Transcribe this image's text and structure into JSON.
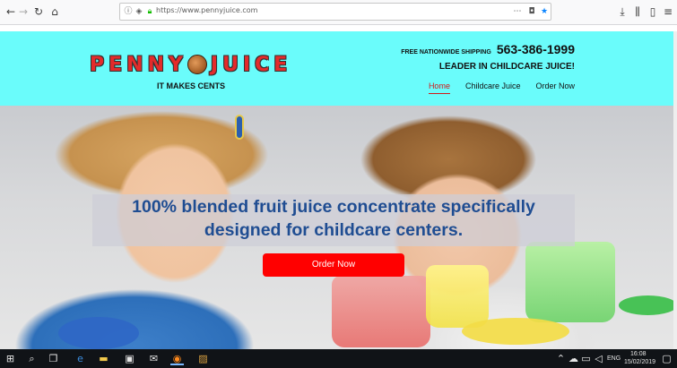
{
  "browser": {
    "url": "https://www.pennyjuice.com",
    "icons": [
      "arrow-left-icon",
      "arrow-right-icon",
      "reload-icon",
      "home-icon",
      "info-icon",
      "tracking-shield-icon",
      "lock-icon",
      "more-icon",
      "pocket-icon",
      "bookmark-star-icon",
      "download-icon",
      "library-icon",
      "sidebar-icon",
      "menu-icon"
    ]
  },
  "header": {
    "logo": {
      "left": "PENNY",
      "right": "JUICE"
    },
    "tagline": "IT MAKES CENTS",
    "shipping_label": "FREE NATIONWIDE SHIPPING",
    "phone": "563-386-1999",
    "leader": "LEADER IN CHILDCARE JUICE!",
    "nav": [
      {
        "label": "Home",
        "active": true
      },
      {
        "label": "Childcare Juice",
        "active": false
      },
      {
        "label": "Order Now",
        "active": false
      }
    ]
  },
  "hero": {
    "headline_line1": "100% blended fruit juice concentrate specifically",
    "headline_line2": "designed for childcare centers.",
    "cta": "Order Now"
  },
  "taskbar": {
    "language": "ENG",
    "time": "16:08",
    "date": "15/02/2019"
  },
  "colors": {
    "header_bg": "#6afcfb",
    "accent_red": "#ff0000",
    "headline_blue": "#1f4d92"
  }
}
